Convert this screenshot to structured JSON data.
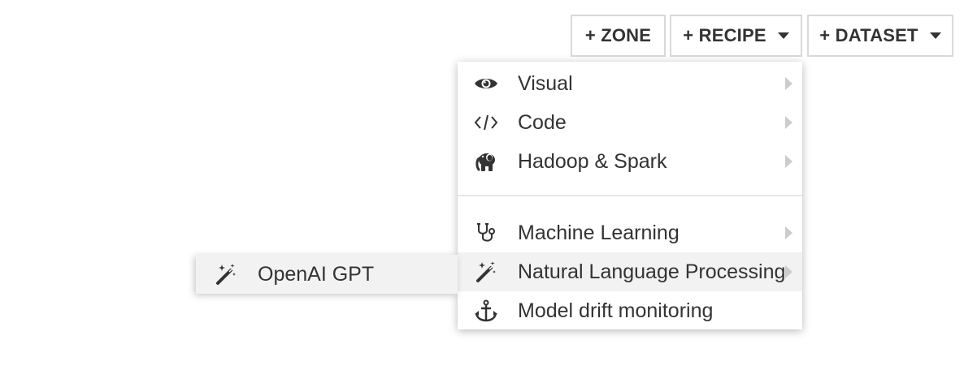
{
  "toolbar": {
    "zone_label": "+ ZONE",
    "recipe_label": "+ RECIPE",
    "dataset_label": "+ DATASET"
  },
  "recipe_menu": {
    "items": [
      {
        "label": "Visual",
        "icon": "eye-icon",
        "has_submenu": true
      },
      {
        "label": "Code",
        "icon": "code-icon",
        "has_submenu": true
      },
      {
        "label": "Hadoop & Spark",
        "icon": "elephant-icon",
        "has_submenu": true
      },
      {
        "label": "Machine Learning",
        "icon": "stethoscope-icon",
        "has_submenu": true
      },
      {
        "label": "Natural Language Processing",
        "icon": "magic-wand-icon",
        "has_submenu": true,
        "highlighted": true
      },
      {
        "label": "Model drift monitoring",
        "icon": "anchor-icon",
        "has_submenu": false
      }
    ]
  },
  "nlp_submenu": {
    "items": [
      {
        "label": "OpenAI GPT",
        "icon": "magic-wand-icon"
      }
    ]
  },
  "colors": {
    "text": "#333333",
    "border": "#d9d9d9",
    "hover_background": "#f2f2f2",
    "submenu_arrow": "#cccccc"
  }
}
